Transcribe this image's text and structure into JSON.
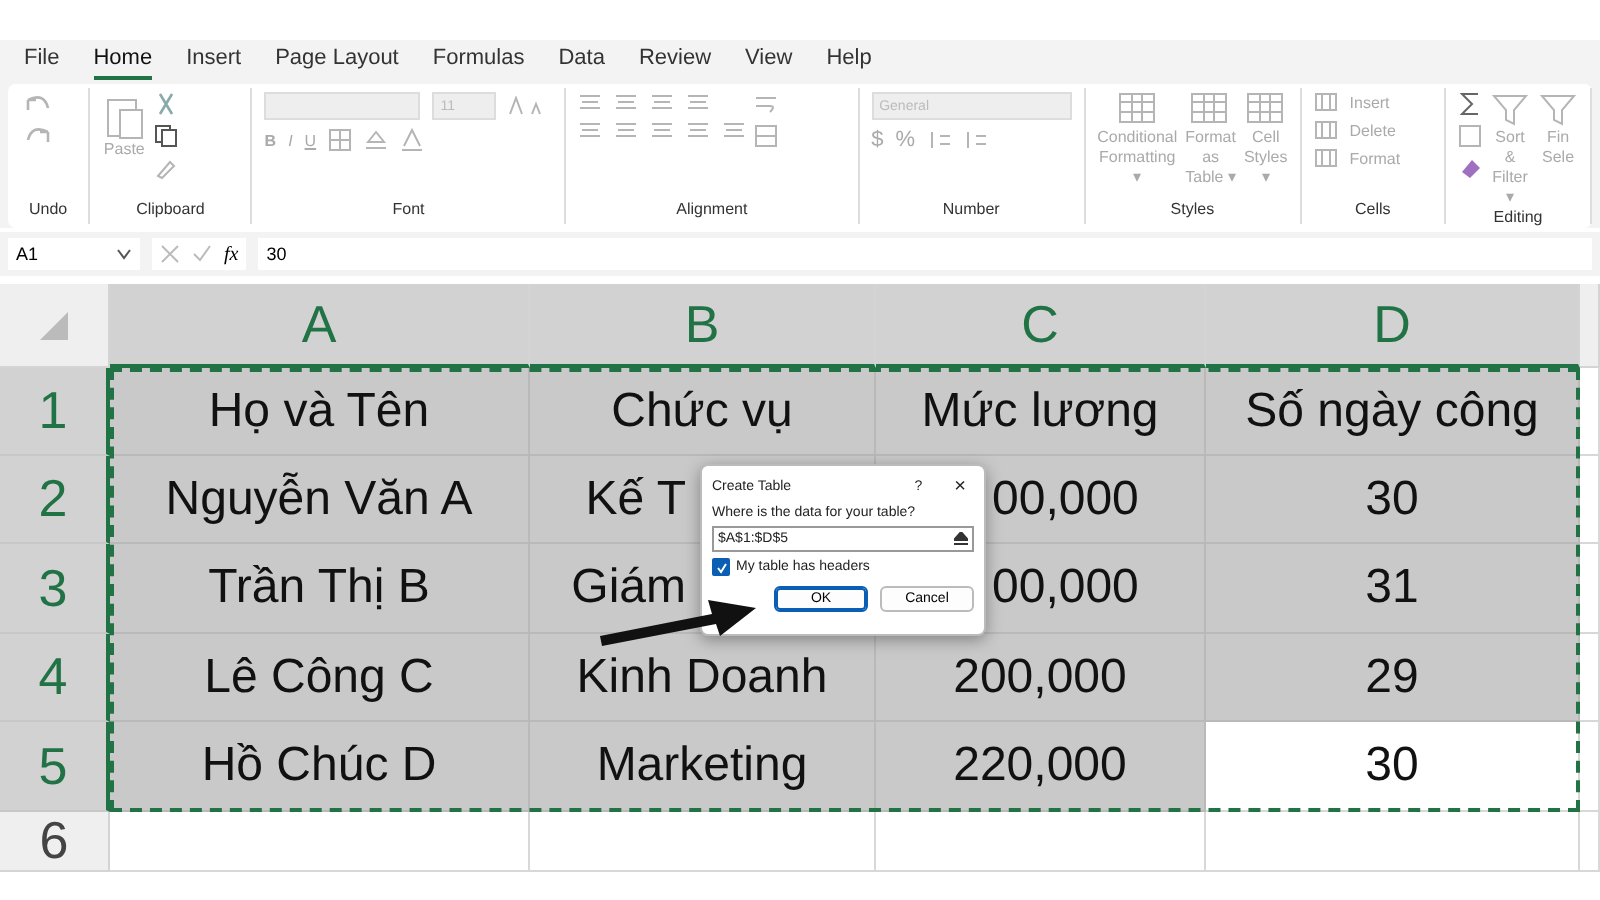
{
  "menu_tabs": [
    {
      "label": "File",
      "selected": false
    },
    {
      "label": "Home",
      "selected": true
    },
    {
      "label": "Insert",
      "selected": false
    },
    {
      "label": "Page Layout",
      "selected": false
    },
    {
      "label": "Formulas",
      "selected": false
    },
    {
      "label": "Data",
      "selected": false
    },
    {
      "label": "Review",
      "selected": false
    },
    {
      "label": "View",
      "selected": false
    },
    {
      "label": "Help",
      "selected": false
    }
  ],
  "ribbon": {
    "disabled": true,
    "groups": [
      {
        "kind": "undo",
        "label": "Undo"
      },
      {
        "kind": "clipboard",
        "label": "Clipboard",
        "paste": "Paste"
      },
      {
        "kind": "font",
        "label": "Font",
        "font_size": "11",
        "styles": [
          "B",
          "I",
          "U"
        ]
      },
      {
        "kind": "alignment",
        "label": "Alignment"
      },
      {
        "kind": "number",
        "label": "Number",
        "format": "General",
        "symbols": [
          "$",
          "%"
        ]
      },
      {
        "kind": "styles",
        "label": "Styles",
        "buttons": [
          {
            "lines": [
              "Conditional",
              "Formatting ▾"
            ]
          },
          {
            "lines": [
              "Format as",
              "Table ▾"
            ]
          },
          {
            "lines": [
              "Cell",
              "Styles ▾"
            ]
          }
        ]
      },
      {
        "kind": "cells",
        "label": "Cells",
        "buttons": [
          "Insert",
          "Delete",
          "Format"
        ]
      },
      {
        "kind": "editing",
        "label": "Editing",
        "buttons": [
          {
            "lines": [
              "Sort &",
              "Filter ▾"
            ]
          },
          {
            "lines": [
              "Fin",
              "Sele"
            ]
          }
        ]
      }
    ]
  },
  "formula_bar": {
    "name_box": "A1",
    "fx": "fx",
    "formula": "30"
  },
  "sheet": {
    "columns": [
      {
        "label": "A",
        "selected": true
      },
      {
        "label": "B",
        "selected": true
      },
      {
        "label": "C",
        "selected": true
      },
      {
        "label": "D",
        "selected": true
      }
    ],
    "rows": [
      {
        "header": "1",
        "selected": true,
        "cells": [
          {
            "text": "Họ và Tên",
            "selected": true
          },
          {
            "text": "Chức vụ",
            "selected": true
          },
          {
            "text": "Mức lương",
            "selected": true
          },
          {
            "text": "Số ngày công",
            "selected": true
          }
        ]
      },
      {
        "header": "2",
        "selected": true,
        "cells": [
          {
            "text": "Nguyễn Văn A",
            "selected": true
          },
          {
            "text": "Kế T",
            "selected": true
          },
          {
            "text": "00,000",
            "selected": true
          },
          {
            "text": "30",
            "selected": true
          }
        ]
      },
      {
        "header": "3",
        "selected": true,
        "cells": [
          {
            "text": "Trần Thị B",
            "selected": true
          },
          {
            "text": "Giám",
            "selected": true
          },
          {
            "text": "00,000",
            "selected": true
          },
          {
            "text": "31",
            "selected": true
          }
        ]
      },
      {
        "header": "4",
        "selected": true,
        "cells": [
          {
            "text": "Lê Công C",
            "selected": true
          },
          {
            "text": "Kinh Doanh",
            "selected": true
          },
          {
            "text": "200,000",
            "selected": true
          },
          {
            "text": "29",
            "selected": true
          }
        ]
      },
      {
        "header": "5",
        "selected": true,
        "cells": [
          {
            "text": "Hồ Chúc D",
            "selected": true
          },
          {
            "text": "Marketing",
            "selected": true
          },
          {
            "text": "220,000",
            "selected": true
          },
          {
            "text": "30",
            "selected": false
          }
        ]
      },
      {
        "header": "6",
        "selected": false,
        "cells": []
      }
    ]
  },
  "dialog": {
    "title": "Create Table",
    "help": "?",
    "close": "×",
    "prompt": "Where is the data for your table?",
    "range": "$A$1:$D$5",
    "headers_checkbox": {
      "label": "My table has headers",
      "checked": true
    },
    "buttons": [
      {
        "label": "OK",
        "default": true
      },
      {
        "label": "Cancel",
        "default": false
      }
    ]
  }
}
